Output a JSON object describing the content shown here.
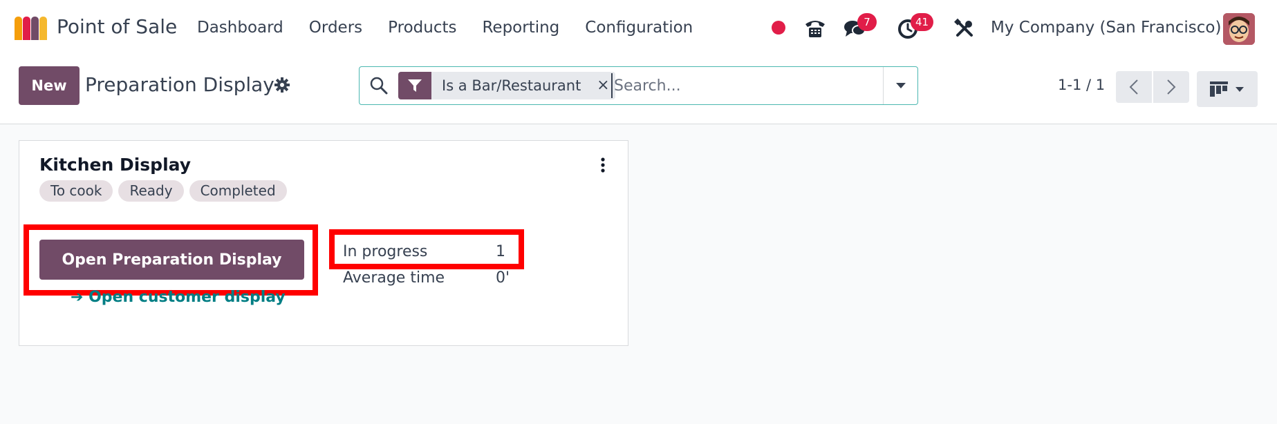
{
  "navbar": {
    "app_name": "Point of Sale",
    "menu": [
      "Dashboard",
      "Orders",
      "Products",
      "Reporting",
      "Configuration"
    ],
    "systray": {
      "messages_badge": "7",
      "activities_badge": "41",
      "company": "My Company (San Francisco)"
    }
  },
  "control": {
    "new_label": "New",
    "title": "Preparation Display",
    "search": {
      "facet": "Is a Bar/Restaurant",
      "facet_remove": "×",
      "placeholder": "Search..."
    },
    "pager": "1-1 / 1"
  },
  "card": {
    "title": "Kitchen Display",
    "tags": [
      "To cook",
      "Ready",
      "Completed"
    ],
    "open_button": "Open Preparation Display",
    "customer_link": "Open customer display",
    "stats": [
      {
        "label": "In progress",
        "value": "1"
      },
      {
        "label": "Average time",
        "value": "0'"
      }
    ]
  },
  "colors": {
    "brand": "#714b67",
    "link": "#017e84",
    "badge": "#e11d48",
    "highlight": "#ff0000"
  }
}
